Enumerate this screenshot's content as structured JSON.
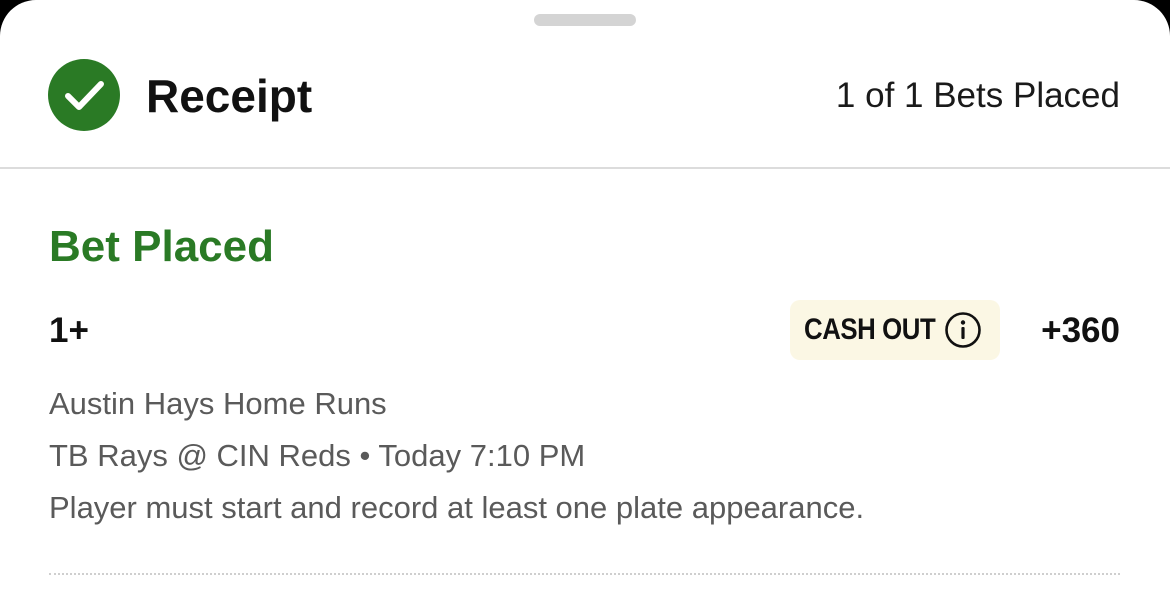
{
  "header": {
    "title": "Receipt",
    "count_text": "1 of 1 Bets Placed",
    "check_icon": "check-circle-icon"
  },
  "bet": {
    "status": "Bet Placed",
    "selection": "1+",
    "cash_out_label": "CASH OUT",
    "info_icon": "info-icon",
    "odds": "+360",
    "market": "Austin Hays Home Runs",
    "matchup": "TB Rays @ CIN Reds • Today 7:10 PM",
    "rule": "Player must start and record at least one plate appearance."
  },
  "colors": {
    "accent_green": "#2a7a25",
    "cash_out_bg": "#fbf7e4",
    "text_primary": "#111111",
    "text_secondary": "#5a5a5a"
  }
}
